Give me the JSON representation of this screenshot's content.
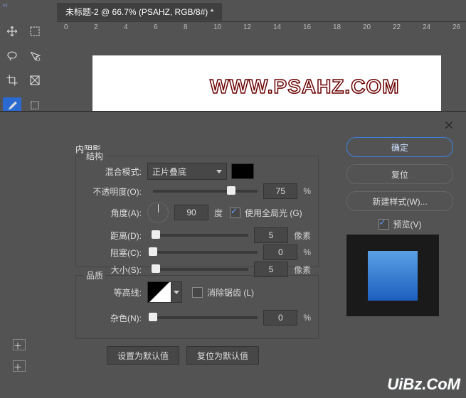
{
  "collapse_indicator": "‹‹",
  "tab_title": "未标题-2 @ 66.7% (PSAHZ, RGB/8#) *",
  "ruler": [
    "0",
    "2",
    "4",
    "6",
    "8",
    "10",
    "12",
    "14",
    "16",
    "18",
    "20",
    "22",
    "24",
    "26"
  ],
  "canvas_watermark": "WWW.PSAHZ.COM",
  "footer_watermark": "UiBz.CoM",
  "dialog": {
    "title": "内阴影",
    "structure_legend": "结构",
    "quality_legend": "品质",
    "blend_mode_label": "混合模式:",
    "blend_mode_value": "正片叠底",
    "opacity_label": "不透明度(O):",
    "opacity_value": "75",
    "opacity_unit": "%",
    "angle_label": "角度(A):",
    "angle_value": "90",
    "angle_unit": "度",
    "use_global_label": "使用全局光 (G)",
    "distance_label": "距离(D):",
    "distance_value": "5",
    "distance_unit": "像素",
    "choke_label": "阻塞(C):",
    "choke_value": "0",
    "choke_unit": "%",
    "size_label": "大小(S):",
    "size_value": "5",
    "size_unit": "像素",
    "contour_label": "等高线:",
    "antialias_label": "消除锯齿 (L)",
    "noise_label": "杂色(N):",
    "noise_value": "0",
    "noise_unit": "%",
    "default_btn": "设置为默认值",
    "reset_default_btn": "复位为默认值",
    "ok": "确定",
    "reset": "复位",
    "new_style": "新建样式(W)...",
    "preview_label": "预览(V)"
  }
}
